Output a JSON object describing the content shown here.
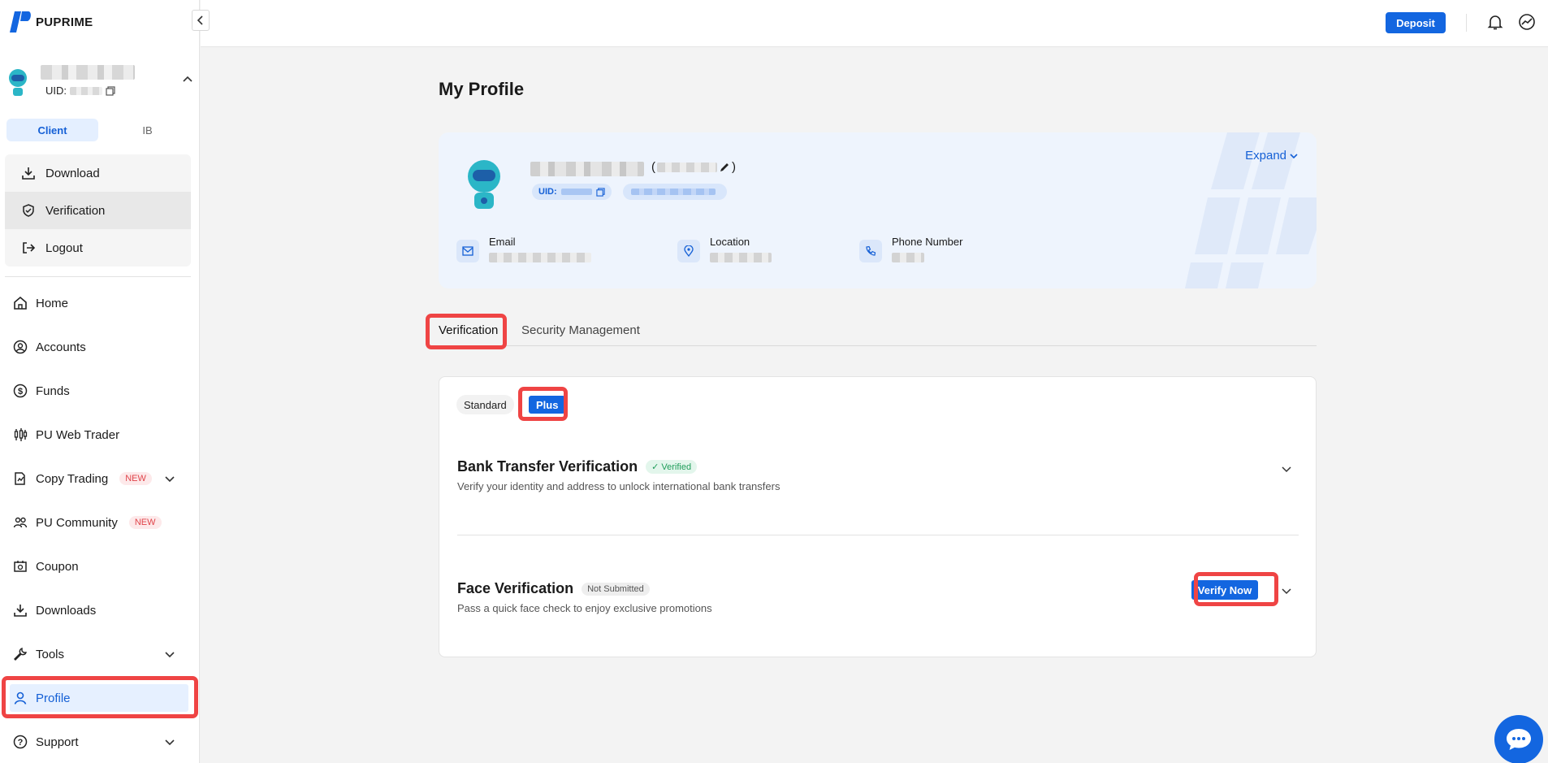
{
  "brand": {
    "name": "PUPRIME",
    "accent": "#1366e0"
  },
  "user": {
    "uid_label": "UID:"
  },
  "roles": {
    "client": "Client",
    "ib": "IB"
  },
  "quick_menu": [
    {
      "label": "Download",
      "icon": "download-icon"
    },
    {
      "label": "Verification",
      "icon": "shield-check-icon"
    },
    {
      "label": "Logout",
      "icon": "logout-icon"
    }
  ],
  "nav": [
    {
      "label": "Home",
      "icon": "home-icon"
    },
    {
      "label": "Accounts",
      "icon": "user-circle-icon"
    },
    {
      "label": "Funds",
      "icon": "dollar-icon"
    },
    {
      "label": "PU Web Trader",
      "icon": "candlestick-icon"
    },
    {
      "label": "Copy Trading",
      "icon": "copy-trading-icon",
      "badge": "NEW",
      "expandable": true
    },
    {
      "label": "PU Community",
      "icon": "community-icon",
      "badge": "NEW"
    },
    {
      "label": "Coupon",
      "icon": "coupon-icon"
    },
    {
      "label": "Downloads",
      "icon": "download-icon"
    },
    {
      "label": "Tools",
      "icon": "wrench-icon",
      "expandable": true
    },
    {
      "label": "Profile",
      "icon": "person-icon",
      "active": true
    },
    {
      "label": "Support",
      "icon": "help-icon",
      "expandable": true
    }
  ],
  "topbar": {
    "deposit_label": "Deposit"
  },
  "page": {
    "title": "My Profile",
    "profile_card": {
      "uid_label": "UID:",
      "expand_label": "Expand",
      "email_label": "Email",
      "location_label": "Location",
      "phone_label": "Phone Number"
    },
    "tabs": [
      "Verification",
      "Security Management"
    ],
    "segments": {
      "standard": "Standard",
      "plus": "Plus"
    },
    "verifications": [
      {
        "title": "Bank Transfer Verification",
        "status": "Verified",
        "description": "Verify your identity and address to unlock international bank transfers"
      },
      {
        "title": "Face Verification",
        "status": "Not Submitted",
        "description": "Pass a quick face check to enjoy exclusive promotions",
        "action": "Verify Now"
      }
    ]
  }
}
